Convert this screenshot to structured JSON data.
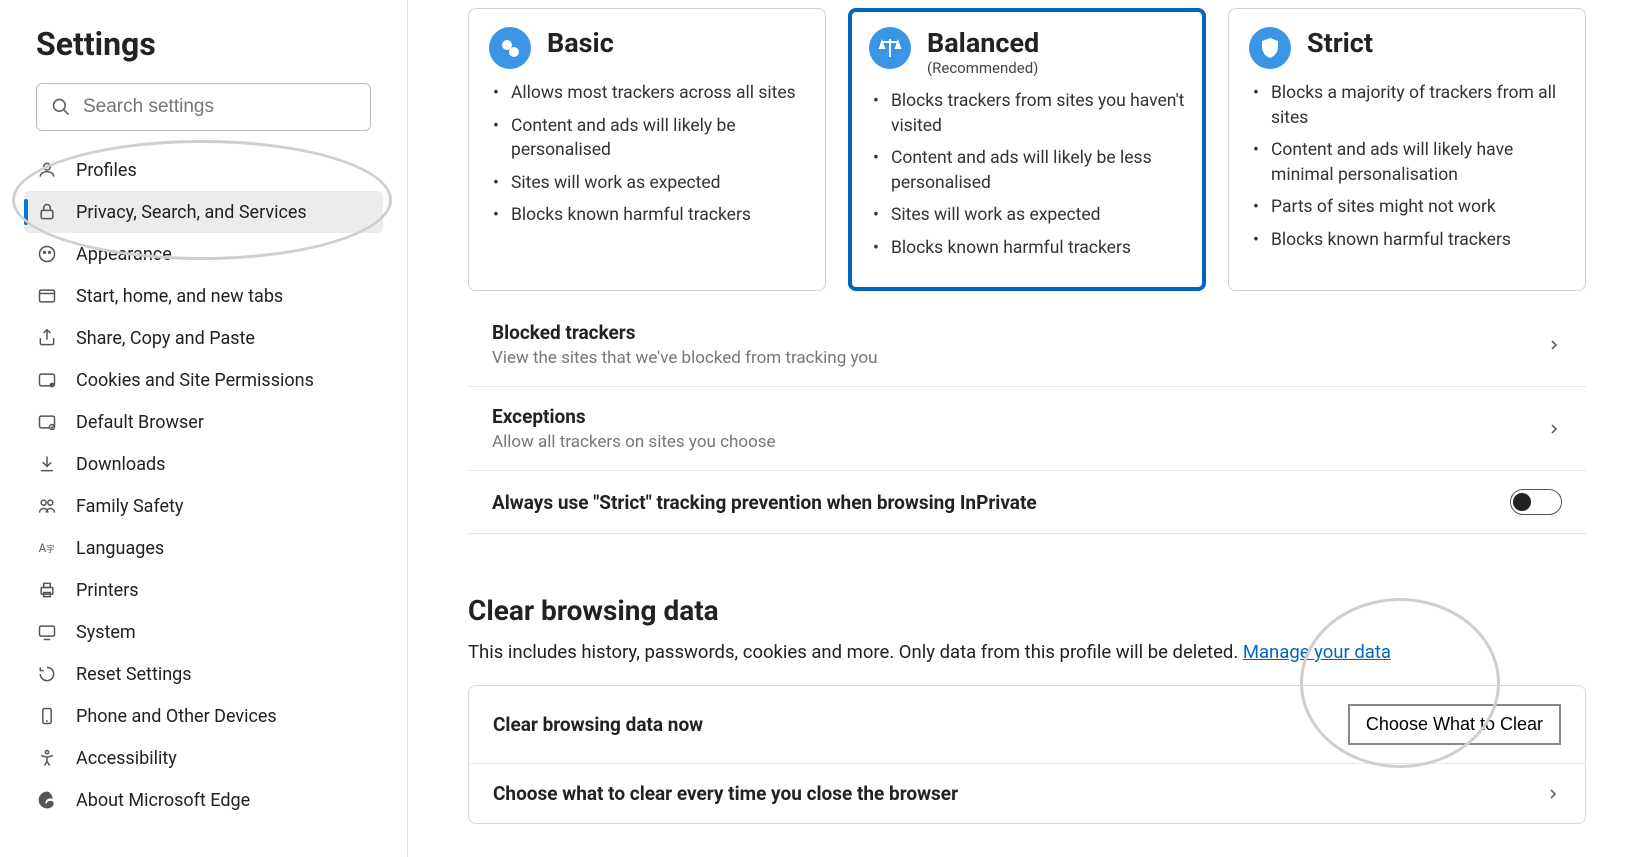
{
  "sidebar": {
    "title": "Settings",
    "search_placeholder": "Search settings",
    "items": [
      {
        "label": "Profiles"
      },
      {
        "label": "Privacy, Search, and Services"
      },
      {
        "label": "Appearance"
      },
      {
        "label": "Start, home, and new tabs"
      },
      {
        "label": "Share, Copy and Paste"
      },
      {
        "label": "Cookies and Site Permissions"
      },
      {
        "label": "Default Browser"
      },
      {
        "label": "Downloads"
      },
      {
        "label": "Family Safety"
      },
      {
        "label": "Languages"
      },
      {
        "label": "Printers"
      },
      {
        "label": "System"
      },
      {
        "label": "Reset Settings"
      },
      {
        "label": "Phone and Other Devices"
      },
      {
        "label": "Accessibility"
      },
      {
        "label": "About Microsoft Edge"
      }
    ]
  },
  "tracking": {
    "cards": [
      {
        "title": "Basic",
        "subtitle": "",
        "points": [
          "Allows most trackers across all sites",
          "Content and ads will likely be personalised",
          "Sites will work as expected",
          "Blocks known harmful trackers"
        ]
      },
      {
        "title": "Balanced",
        "subtitle": "(Recommended)",
        "selected": true,
        "points": [
          "Blocks trackers from sites you haven't visited",
          "Content and ads will likely be less personalised",
          "Sites will work as expected",
          "Blocks known harmful trackers"
        ]
      },
      {
        "title": "Strict",
        "subtitle": "",
        "points": [
          "Blocks a majority of trackers from all sites",
          "Content and ads will likely have minimal personalisation",
          "Parts of sites might not work",
          "Blocks known harmful trackers"
        ]
      }
    ],
    "rows": {
      "blocked_title": "Blocked trackers",
      "blocked_desc": "View the sites that we've blocked from tracking you",
      "exceptions_title": "Exceptions",
      "exceptions_desc": "Allow all trackers on sites you choose",
      "strict_inprivate": "Always use \"Strict\" tracking prevention when browsing InPrivate"
    }
  },
  "clear": {
    "heading": "Clear browsing data",
    "paragraph_a": "This includes history, passwords, cookies and more. Only data from this profile will be deleted. ",
    "manage_link": "Manage your data",
    "row1_title": "Clear browsing data now",
    "row1_button": "Choose What to Clear",
    "row2_title": "Choose what to clear every time you close the browser"
  }
}
